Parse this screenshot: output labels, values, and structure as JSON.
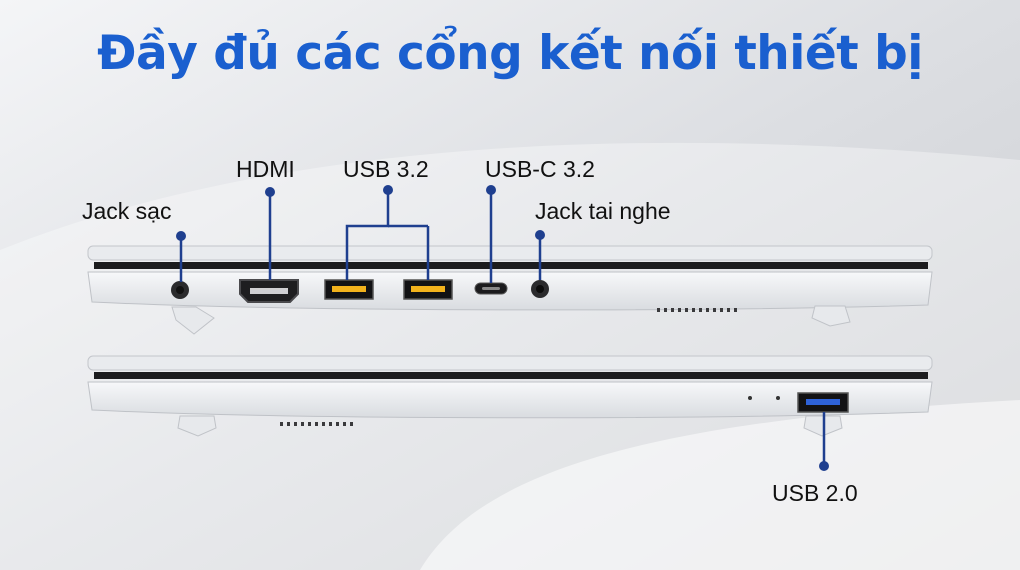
{
  "title": "Đầy đủ các cổng kết nối thiết bị",
  "labels": {
    "jack_sac": "Jack sạc",
    "hdmi": "HDMI",
    "usb_32": "USB 3.2",
    "usb_c_32": "USB-C 3.2",
    "jack_tai_nghe": "Jack tai nghe",
    "usb_20": "USB 2.0"
  },
  "colors": {
    "title": "#1a5fcf",
    "pointer": "#1f3f8f",
    "laptop_body": "#eef0f3"
  }
}
